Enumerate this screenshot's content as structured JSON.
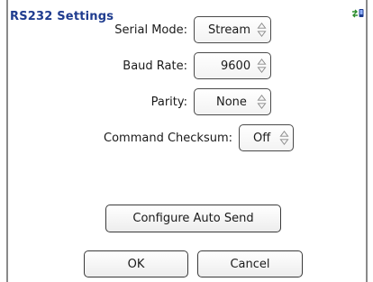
{
  "window": {
    "title": "RS232 Settings",
    "status_icon": "connection-arrows-icon",
    "accent": "#1f3c8f"
  },
  "form": {
    "serial_mode": {
      "label": "Serial Mode:",
      "value": "Stream"
    },
    "baud_rate": {
      "label": "Baud Rate:",
      "value": "9600"
    },
    "parity": {
      "label": "Parity:",
      "value": "None"
    },
    "command_checksum": {
      "label": "Command Checksum:",
      "value": "Off"
    }
  },
  "buttons": {
    "configure_auto_send": "Configure Auto Send",
    "ok": "OK",
    "cancel": "Cancel"
  }
}
